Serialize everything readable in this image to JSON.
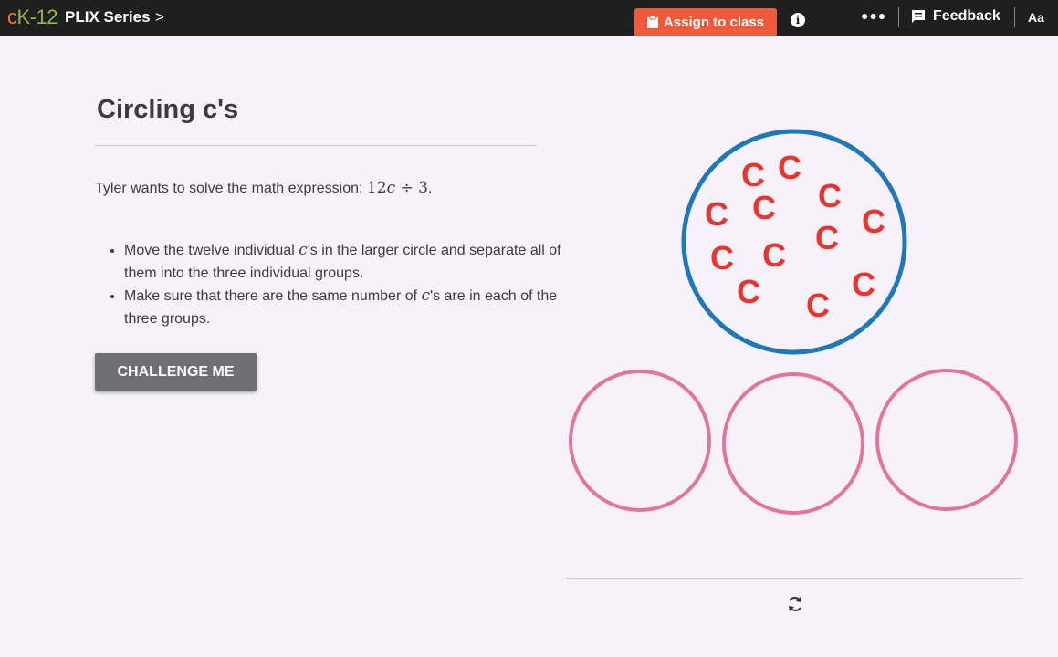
{
  "topbar": {
    "logo_c": "c",
    "logo_k": "K-12",
    "series_label": "PLIX Series",
    "series_chevron": ">",
    "assign_label": "Assign to class",
    "info_glyph": "i",
    "more_glyph": "●●●",
    "feedback_label": "Feedback",
    "text_size_label": "Aa"
  },
  "lesson": {
    "title": "Circling c's",
    "prompt_text": "Tyler wants to solve the math expression: ",
    "expr_num": "12",
    "expr_var": "c",
    "expr_rest": " ÷ 3",
    "expr_end": ".",
    "instructions": [
      {
        "a": "Move the twelve individual ",
        "var": "c",
        "b": "'s  in the larger circle and separate all of them into the three individual groups."
      },
      {
        "a": "Make sure that there are the same number of ",
        "var": "c",
        "b": "'s are in each of the three groups."
      }
    ],
    "challenge_label": "CHALLENGE ME"
  },
  "activity": {
    "big_circle_color": "#1f78b8",
    "small_circle_color": "#e0769f",
    "letter_color": "#e8352e",
    "letter": "C",
    "letter_count": 12,
    "group_count": 3
  },
  "icons": {
    "assign": "clipboard-icon",
    "info": "info-icon",
    "more": "more-icon",
    "feedback": "feedback-icon",
    "reset": "refresh-icon"
  }
}
